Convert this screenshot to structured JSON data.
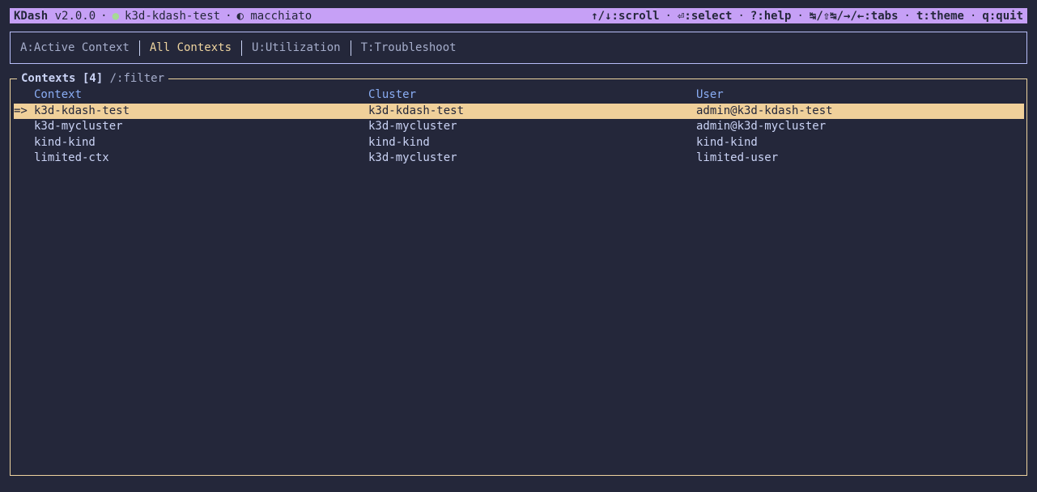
{
  "topbar": {
    "app": "KDash",
    "version": "v2.0.0",
    "separator": "·",
    "context": "k3d-kdash-test",
    "theme_icon": "◐",
    "theme": "macchiato",
    "hints": [
      {
        "key": "↑/↓",
        "label": "scroll"
      },
      {
        "key": "⏎",
        "label": "select"
      },
      {
        "key": "?",
        "label": "help"
      },
      {
        "key": "↹/⇧↹/→/←",
        "label": "tabs"
      },
      {
        "key": "t",
        "label": "theme"
      },
      {
        "key": "q",
        "label": "quit"
      }
    ]
  },
  "tabs": [
    {
      "label": "A:Active Context",
      "active": false
    },
    {
      "label": "All Contexts",
      "active": true
    },
    {
      "label": "U:Utilization",
      "active": false
    },
    {
      "label": "T:Troubleshoot",
      "active": false
    }
  ],
  "panel": {
    "title": "Contexts [4]",
    "filter_hint": "/:filter"
  },
  "table": {
    "columns": [
      "Context",
      "Cluster",
      "User"
    ],
    "selected_marker": "=>",
    "rows": [
      {
        "context": "k3d-kdash-test",
        "cluster": "k3d-kdash-test",
        "user": "admin@k3d-kdash-test",
        "selected": true
      },
      {
        "context": "k3d-mycluster",
        "cluster": "k3d-mycluster",
        "user": "admin@k3d-mycluster",
        "selected": false
      },
      {
        "context": "kind-kind",
        "cluster": "kind-kind",
        "user": "kind-kind",
        "selected": false
      },
      {
        "context": "limited-ctx",
        "cluster": "k3d-mycluster",
        "user": "limited-user",
        "selected": false
      }
    ]
  },
  "colors": {
    "background": "#24273a",
    "topbar": "#c6a0f6",
    "selected_row": "#f0d09a",
    "active_tab": "#eed49f",
    "column_header": "#8aadf4",
    "status_dot": "#a6da95"
  }
}
